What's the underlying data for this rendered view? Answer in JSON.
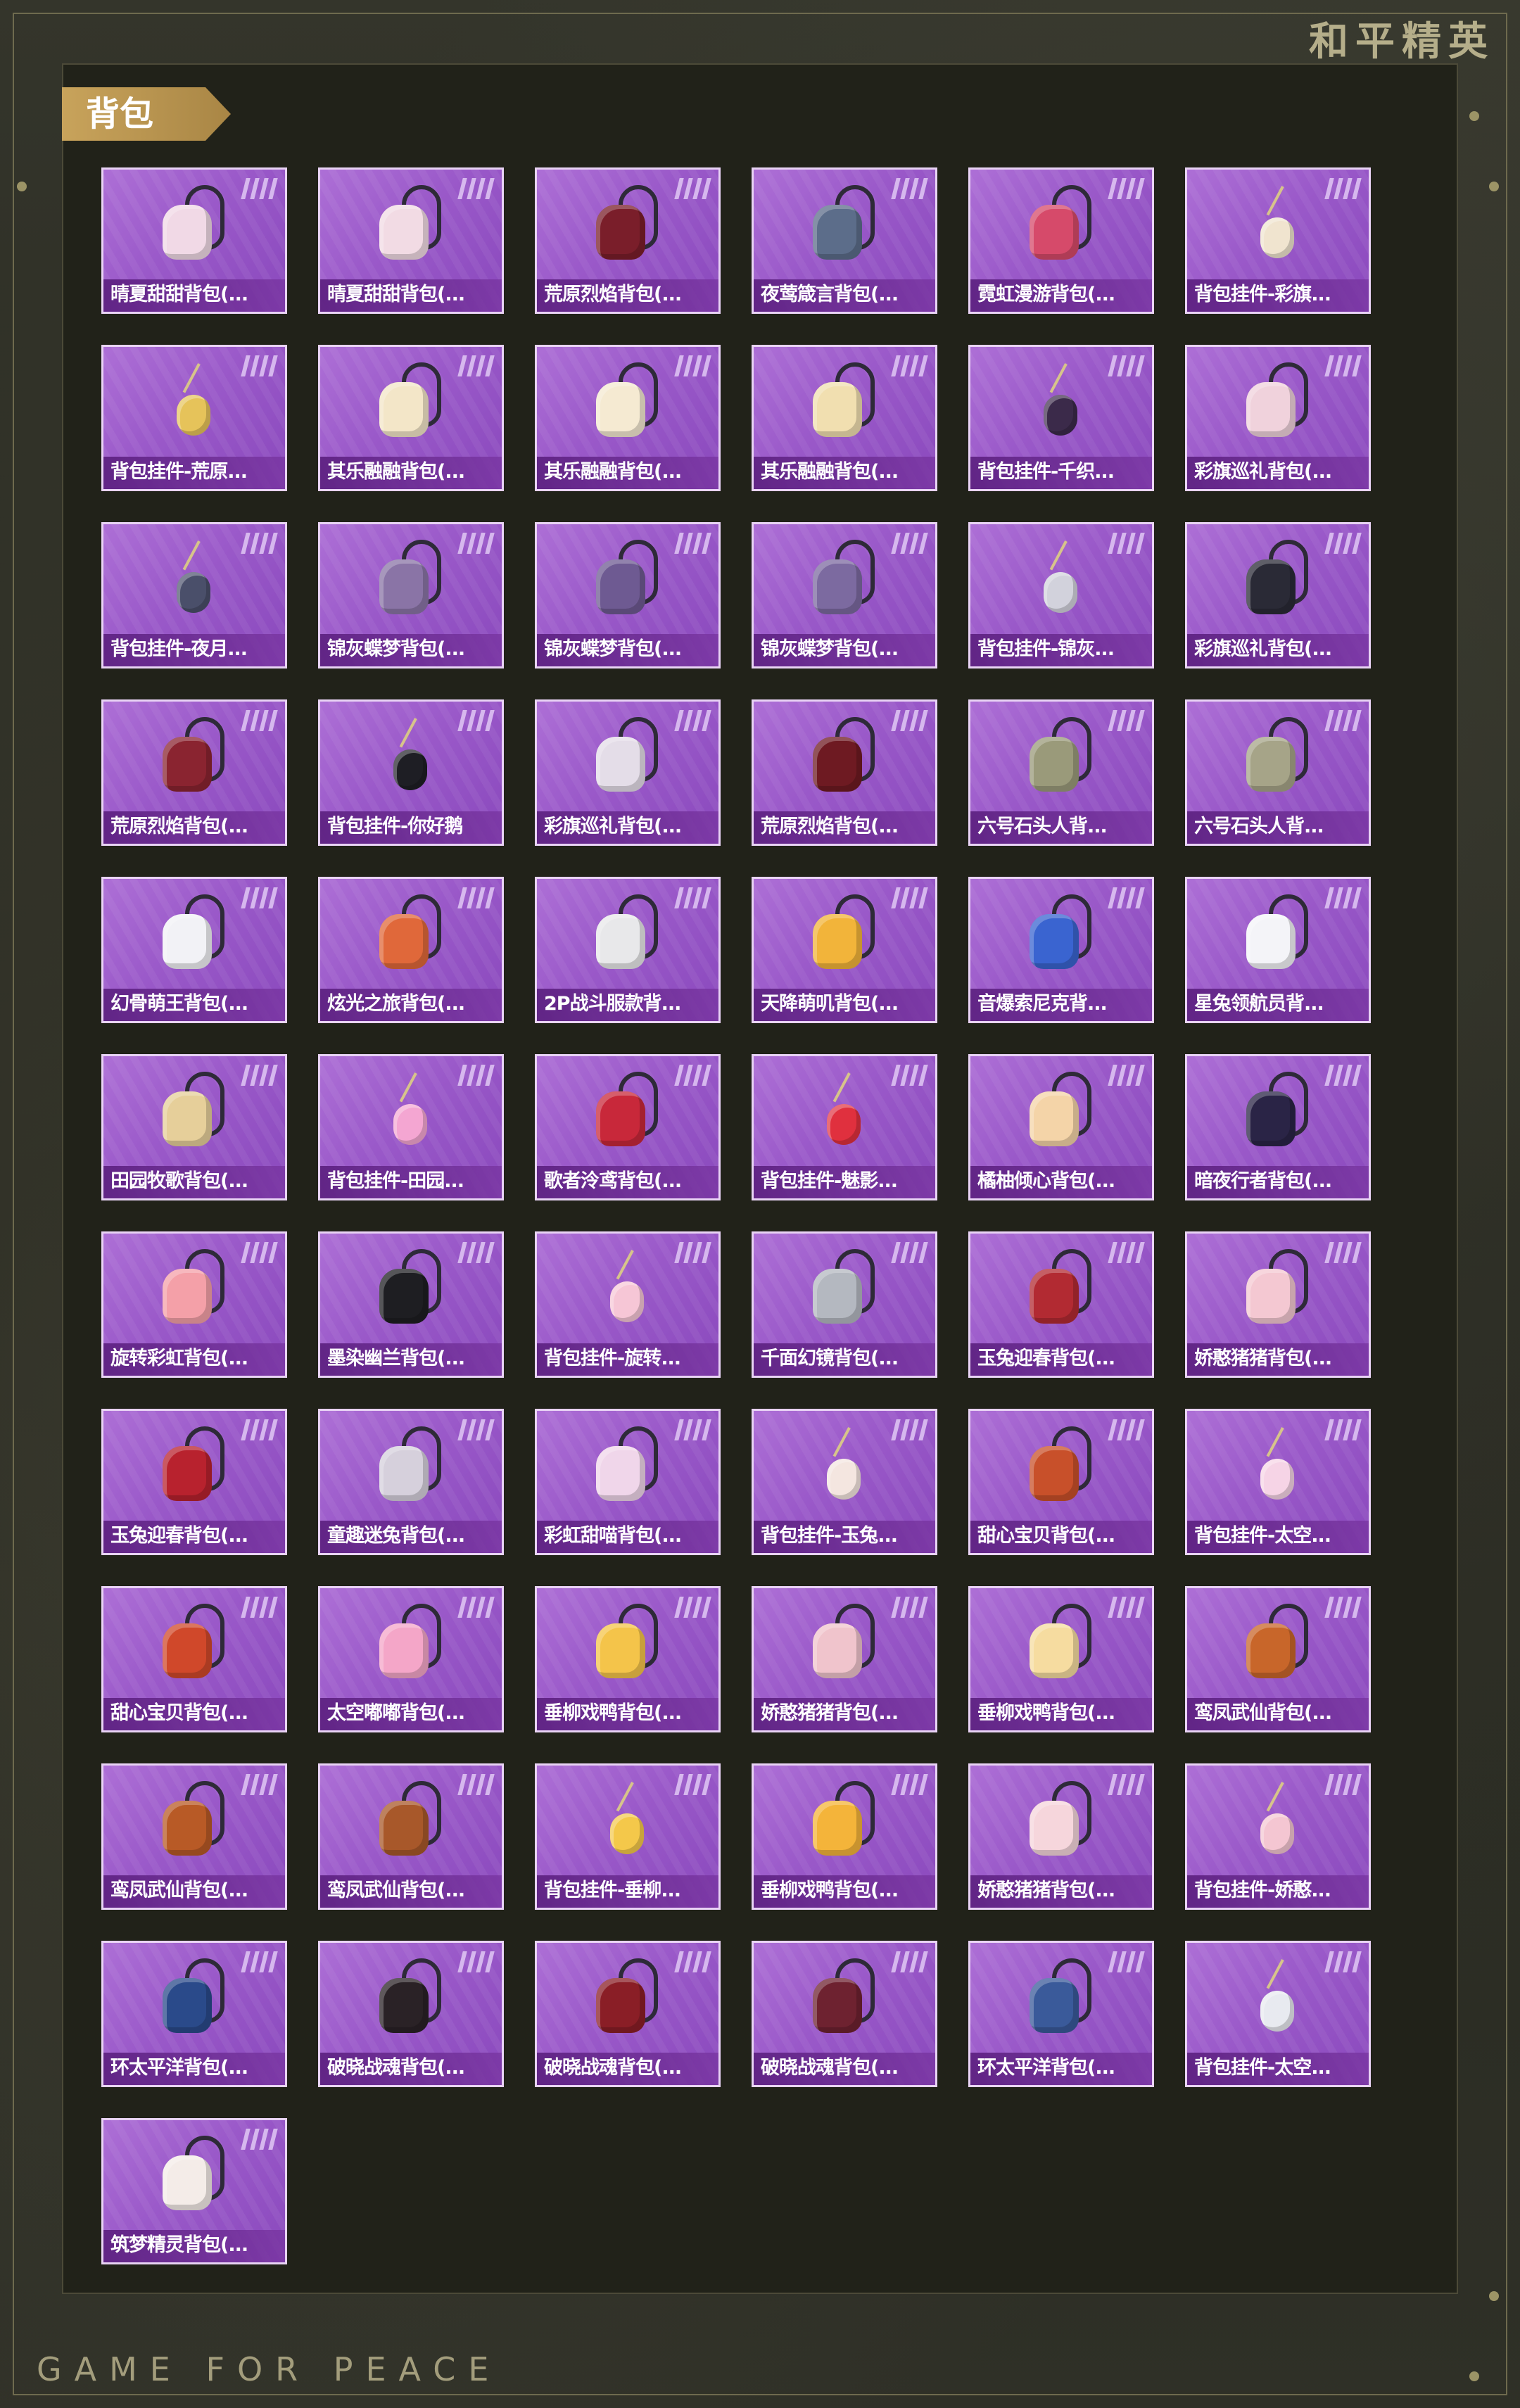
{
  "header": {
    "brand": "和平精英"
  },
  "section": {
    "title": "背包"
  },
  "footer": {
    "brand": "GAME FOR PEACE"
  },
  "items": [
    {
      "name": "晴夏甜甜背包(...",
      "icon": "bunny-backpack-icon",
      "kind": "pack",
      "color": "#f1d9e6"
    },
    {
      "name": "晴夏甜甜背包(...",
      "icon": "bunny-backpack-icon",
      "kind": "pack",
      "color": "#f2dbe4"
    },
    {
      "name": "荒原烈焰背包(...",
      "icon": "flame-backpack-icon",
      "kind": "pack",
      "color": "#7a1e2a"
    },
    {
      "name": "夜莺箴言背包(...",
      "icon": "nightingale-backpack-icon",
      "kind": "pack",
      "color": "#5c6d8a"
    },
    {
      "name": "霓虹漫游背包(...",
      "icon": "neon-backpack-icon",
      "kind": "pack",
      "color": "#d64a6a"
    },
    {
      "name": "背包挂件-彩旗...",
      "icon": "ice-cream-charm-icon",
      "kind": "charm",
      "color": "#f0e4cf"
    },
    {
      "name": "背包挂件-荒原...",
      "icon": "star-charm-icon",
      "kind": "charm",
      "color": "#e6c35a"
    },
    {
      "name": "其乐融融背包(...",
      "icon": "cake-backpack-icon",
      "kind": "pack",
      "color": "#f3e6c8"
    },
    {
      "name": "其乐融融背包(...",
      "icon": "cake-backpack-icon",
      "kind": "pack",
      "color": "#f5ead2"
    },
    {
      "name": "其乐融融背包(...",
      "icon": "cake-backpack-icon",
      "kind": "pack",
      "color": "#f1dfb0"
    },
    {
      "name": "背包挂件-千织...",
      "icon": "ornament-charm-icon",
      "kind": "charm",
      "color": "#3b2a4a"
    },
    {
      "name": "彩旗巡礼背包(...",
      "icon": "bunny-backpack-icon",
      "kind": "pack",
      "color": "#f0d2dc"
    },
    {
      "name": "背包挂件-夜月...",
      "icon": "sword-charm-icon",
      "kind": "charm",
      "color": "#4a4f6a"
    },
    {
      "name": "锦灰蝶梦背包(...",
      "icon": "butterfly-backpack-icon",
      "kind": "pack",
      "color": "#8a74a6"
    },
    {
      "name": "锦灰蝶梦背包(...",
      "icon": "butterfly-backpack-icon",
      "kind": "pack",
      "color": "#6e5a92"
    },
    {
      "name": "锦灰蝶梦背包(...",
      "icon": "butterfly-backpack-icon",
      "kind": "pack",
      "color": "#7c6aa0"
    },
    {
      "name": "背包挂件-锦灰...",
      "icon": "feather-charm-icon",
      "kind": "charm",
      "color": "#d2d2dc"
    },
    {
      "name": "彩旗巡礼背包(...",
      "icon": "bunny-backpack-icon",
      "kind": "pack",
      "color": "#2a2a36"
    },
    {
      "name": "荒原烈焰背包(...",
      "icon": "flame-backpack-icon",
      "kind": "pack",
      "color": "#8a2430"
    },
    {
      "name": "背包挂件-你好鹅",
      "icon": "penguin-charm-icon",
      "kind": "charm",
      "color": "#1e1e24"
    },
    {
      "name": "彩旗巡礼背包(...",
      "icon": "rabbit-backpack-icon",
      "kind": "pack",
      "color": "#e4dde8"
    },
    {
      "name": "荒原烈焰背包(...",
      "icon": "flame-backpack-icon",
      "kind": "pack",
      "color": "#6e1a22"
    },
    {
      "name": "六号石头人背...",
      "icon": "stone-golem-backpack-icon",
      "kind": "pack",
      "color": "#9a9a7a"
    },
    {
      "name": "六号石头人背...",
      "icon": "stone-golem-backpack-icon",
      "kind": "pack",
      "color": "#a6a488"
    },
    {
      "name": "幻骨萌王背包(...",
      "icon": "ghost-backpack-icon",
      "kind": "pack",
      "color": "#f2f2f6"
    },
    {
      "name": "炫光之旅背包(...",
      "icon": "arcade-backpack-icon",
      "kind": "pack",
      "color": "#e0683a"
    },
    {
      "name": "2P战斗服款背...",
      "icon": "white-backpack-icon",
      "kind": "pack",
      "color": "#e8e8ea"
    },
    {
      "name": "天降萌叽背包(...",
      "icon": "yellow-bag-icon",
      "kind": "pack",
      "color": "#f2b43a"
    },
    {
      "name": "音爆索尼克背...",
      "icon": "sonic-backpack-icon",
      "kind": "pack",
      "color": "#3a64d0"
    },
    {
      "name": "星兔领航员背...",
      "icon": "astronaut-bunny-backpack-icon",
      "kind": "pack",
      "color": "#f4f4f8"
    },
    {
      "name": "田园牧歌背包(...",
      "icon": "basket-backpack-icon",
      "kind": "pack",
      "color": "#e6cf9a"
    },
    {
      "name": "背包挂件-田园...",
      "icon": "card-charm-icon",
      "kind": "charm",
      "color": "#f4a6d2"
    },
    {
      "name": "歌者泠鸢背包(...",
      "icon": "drawstring-backpack-icon",
      "kind": "pack",
      "color": "#c8283a"
    },
    {
      "name": "背包挂件-魅影...",
      "icon": "heart-charm-icon",
      "kind": "charm",
      "color": "#e0303e"
    },
    {
      "name": "橘柚倾心背包(...",
      "icon": "cat-backpack-icon",
      "kind": "pack",
      "color": "#f4d4a8"
    },
    {
      "name": "暗夜行者背包(...",
      "icon": "dark-backpack-icon",
      "kind": "pack",
      "color": "#2a2446"
    },
    {
      "name": "旋转彩虹背包(...",
      "icon": "rainbow-backpack-icon",
      "kind": "pack",
      "color": "#f4a0a8"
    },
    {
      "name": "墨染幽兰背包(...",
      "icon": "ink-backpack-icon",
      "kind": "pack",
      "color": "#1e1e22"
    },
    {
      "name": "背包挂件-旋转...",
      "icon": "unicorn-charm-icon",
      "kind": "charm",
      "color": "#f6c6d6"
    },
    {
      "name": "千面幻镜背包(...",
      "icon": "mirror-backpack-icon",
      "kind": "pack",
      "color": "#b4b8c0"
    },
    {
      "name": "玉兔迎春背包(...",
      "icon": "spring-backpack-icon",
      "kind": "pack",
      "color": "#b22a32"
    },
    {
      "name": "娇憨猪猪背包(...",
      "icon": "pig-backpack-icon",
      "kind": "pack",
      "color": "#f4c8d2"
    },
    {
      "name": "玉兔迎春背包(...",
      "icon": "spring-backpack-icon",
      "kind": "pack",
      "color": "#b8222e"
    },
    {
      "name": "童趣迷兔背包(...",
      "icon": "rabbit-backpack-icon",
      "kind": "pack",
      "color": "#d6d0dc"
    },
    {
      "name": "彩虹甜喵背包(...",
      "icon": "cat-backpack-icon",
      "kind": "pack",
      "color": "#f0d6ea"
    },
    {
      "name": "背包挂件-玉兔...",
      "icon": "bunny-charm-icon",
      "kind": "charm",
      "color": "#f4e6e0"
    },
    {
      "name": "甜心宝贝背包(...",
      "icon": "dessert-backpack-icon",
      "kind": "pack",
      "color": "#c8502a"
    },
    {
      "name": "背包挂件-太空...",
      "icon": "space-bunny-charm-icon",
      "kind": "charm",
      "color": "#f6d4e6"
    },
    {
      "name": "甜心宝贝背包(...",
      "icon": "dessert-backpack-icon",
      "kind": "pack",
      "color": "#d0482a"
    },
    {
      "name": "太空嘟嘟背包(...",
      "icon": "heart-backpack-icon",
      "kind": "pack",
      "color": "#f4a6c8"
    },
    {
      "name": "垂柳戏鸭背包(...",
      "icon": "duck-backpack-icon",
      "kind": "pack",
      "color": "#f4c44a"
    },
    {
      "name": "娇憨猪猪背包(...",
      "icon": "pig-backpack-icon",
      "kind": "pack",
      "color": "#f0c4cc"
    },
    {
      "name": "垂柳戏鸭背包(...",
      "icon": "duck-backpack-icon",
      "kind": "pack",
      "color": "#f6dca0"
    },
    {
      "name": "鸾凤武仙背包(...",
      "icon": "phoenix-backpack-icon",
      "kind": "pack",
      "color": "#c8662a"
    },
    {
      "name": "鸾凤武仙背包(...",
      "icon": "phoenix-backpack-icon",
      "kind": "pack",
      "color": "#b85a26"
    },
    {
      "name": "鸾凤武仙背包(...",
      "icon": "phoenix-backpack-icon",
      "kind": "pack",
      "color": "#a8582a"
    },
    {
      "name": "背包挂件-垂柳...",
      "icon": "duck-charm-icon",
      "kind": "charm",
      "color": "#f4c84a"
    },
    {
      "name": "垂柳戏鸭背包(...",
      "icon": "duck-backpack-icon",
      "kind": "pack",
      "color": "#f4b43a"
    },
    {
      "name": "娇憨猪猪背包(...",
      "icon": "pig-backpack-icon",
      "kind": "pack",
      "color": "#f6d6dc"
    },
    {
      "name": "背包挂件-娇憨...",
      "icon": "pig-charm-icon",
      "kind": "charm",
      "color": "#f4c6d2"
    },
    {
      "name": "环太平洋背包(...",
      "icon": "mecha-backpack-icon",
      "kind": "pack",
      "color": "#2a4a8a"
    },
    {
      "name": "破晓战魂背包(...",
      "icon": "battle-backpack-icon",
      "kind": "pack",
      "color": "#2a2226"
    },
    {
      "name": "破晓战魂背包(...",
      "icon": "battle-backpack-icon",
      "kind": "pack",
      "color": "#8a1e26"
    },
    {
      "name": "破晓战魂背包(...",
      "icon": "battle-backpack-icon",
      "kind": "pack",
      "color": "#6e2230"
    },
    {
      "name": "环太平洋背包(...",
      "icon": "mecha-backpack-icon",
      "kind": "pack",
      "color": "#3a5a9a"
    },
    {
      "name": "背包挂件-太空...",
      "icon": "astronaut-charm-icon",
      "kind": "charm",
      "color": "#e8eaf0"
    },
    {
      "name": "筑梦精灵背包(...",
      "icon": "fairy-backpack-icon",
      "kind": "pack",
      "color": "#f4ece8"
    }
  ]
}
